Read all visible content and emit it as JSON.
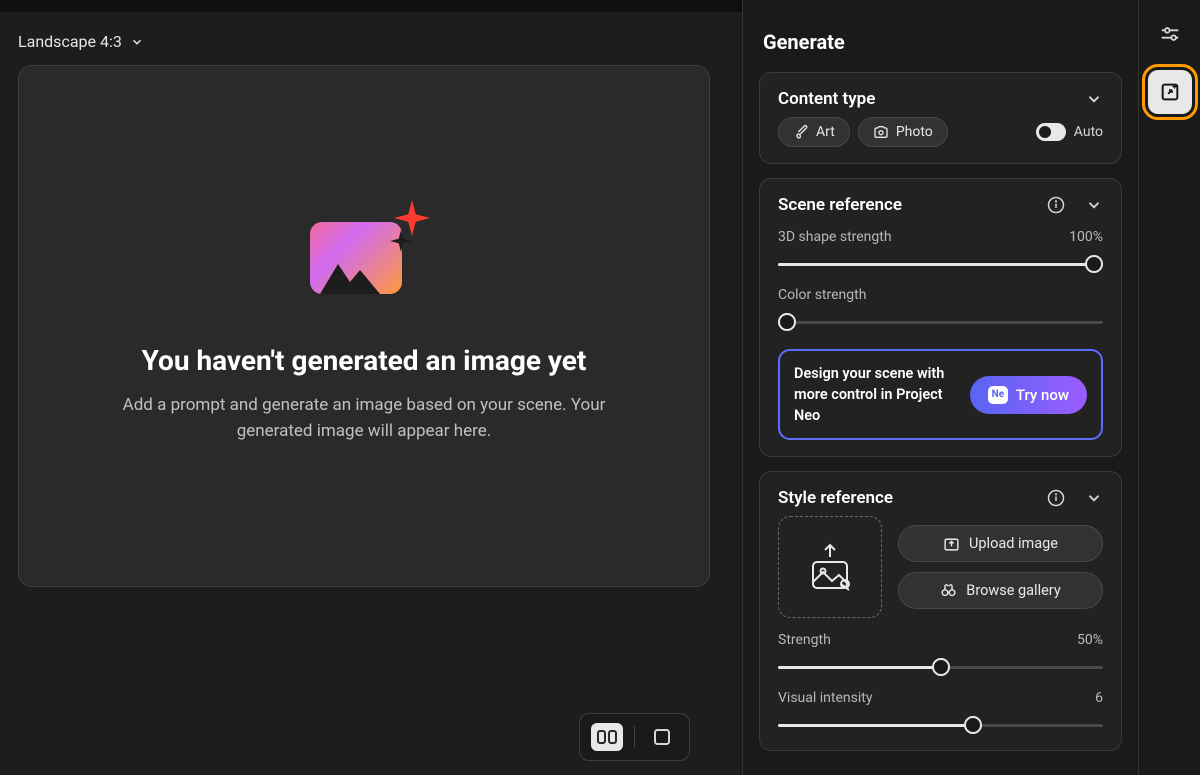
{
  "aspectSelector": {
    "label": "Landscape 4:3"
  },
  "emptyState": {
    "title": "You haven't generated an image yet",
    "description": "Add a prompt and generate an image based on your scene. Your generated image will appear here."
  },
  "panel": {
    "title": "Generate",
    "contentType": {
      "title": "Content type",
      "art": "Art",
      "photo": "Photo",
      "autoLabel": "Auto"
    },
    "sceneRef": {
      "title": "Scene reference",
      "shapeStrengthLabel": "3D shape strength",
      "shapeStrengthValue": "100%",
      "colorStrengthLabel": "Color strength",
      "neoText": "Design your scene with more control in Project Neo",
      "neoBadge": "Ne",
      "neoButton": "Try now"
    },
    "styleRef": {
      "title": "Style reference",
      "uploadLabel": "Upload image",
      "browseLabel": "Browse gallery",
      "strengthLabel": "Strength",
      "strengthValue": "50%",
      "visualIntensityLabel": "Visual intensity",
      "visualIntensityValue": "6"
    }
  },
  "sliders": {
    "shapeStrength": 100,
    "colorStrength": 0,
    "styleStrength": 50,
    "visualIntensity": 60
  }
}
